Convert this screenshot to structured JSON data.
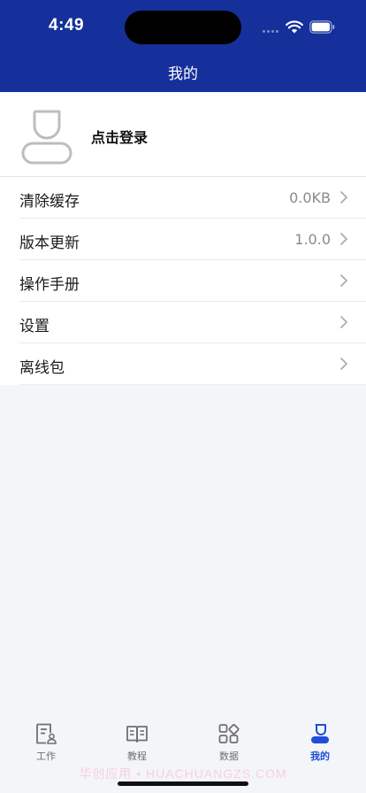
{
  "status_bar": {
    "time": "4:49"
  },
  "nav": {
    "title": "我的"
  },
  "profile": {
    "login_label": "点击登录"
  },
  "menu": [
    {
      "label": "清除缓存",
      "value": "0.0KB"
    },
    {
      "label": "版本更新",
      "value": "1.0.0"
    },
    {
      "label": "操作手册",
      "value": ""
    },
    {
      "label": "设置",
      "value": ""
    },
    {
      "label": "离线包",
      "value": ""
    }
  ],
  "tabs": [
    {
      "label": "工作",
      "icon": "work-document-icon",
      "active": false
    },
    {
      "label": "教程",
      "icon": "book-icon",
      "active": false
    },
    {
      "label": "数据",
      "icon": "grid-data-icon",
      "active": false
    },
    {
      "label": "我的",
      "icon": "user-profile-icon",
      "active": true
    }
  ],
  "watermark": "华创应用 • HUACHUANGZS.COM",
  "colors": {
    "header": "#15309a",
    "active_tab": "#1d4fd6",
    "background": "#f4f5f9"
  }
}
